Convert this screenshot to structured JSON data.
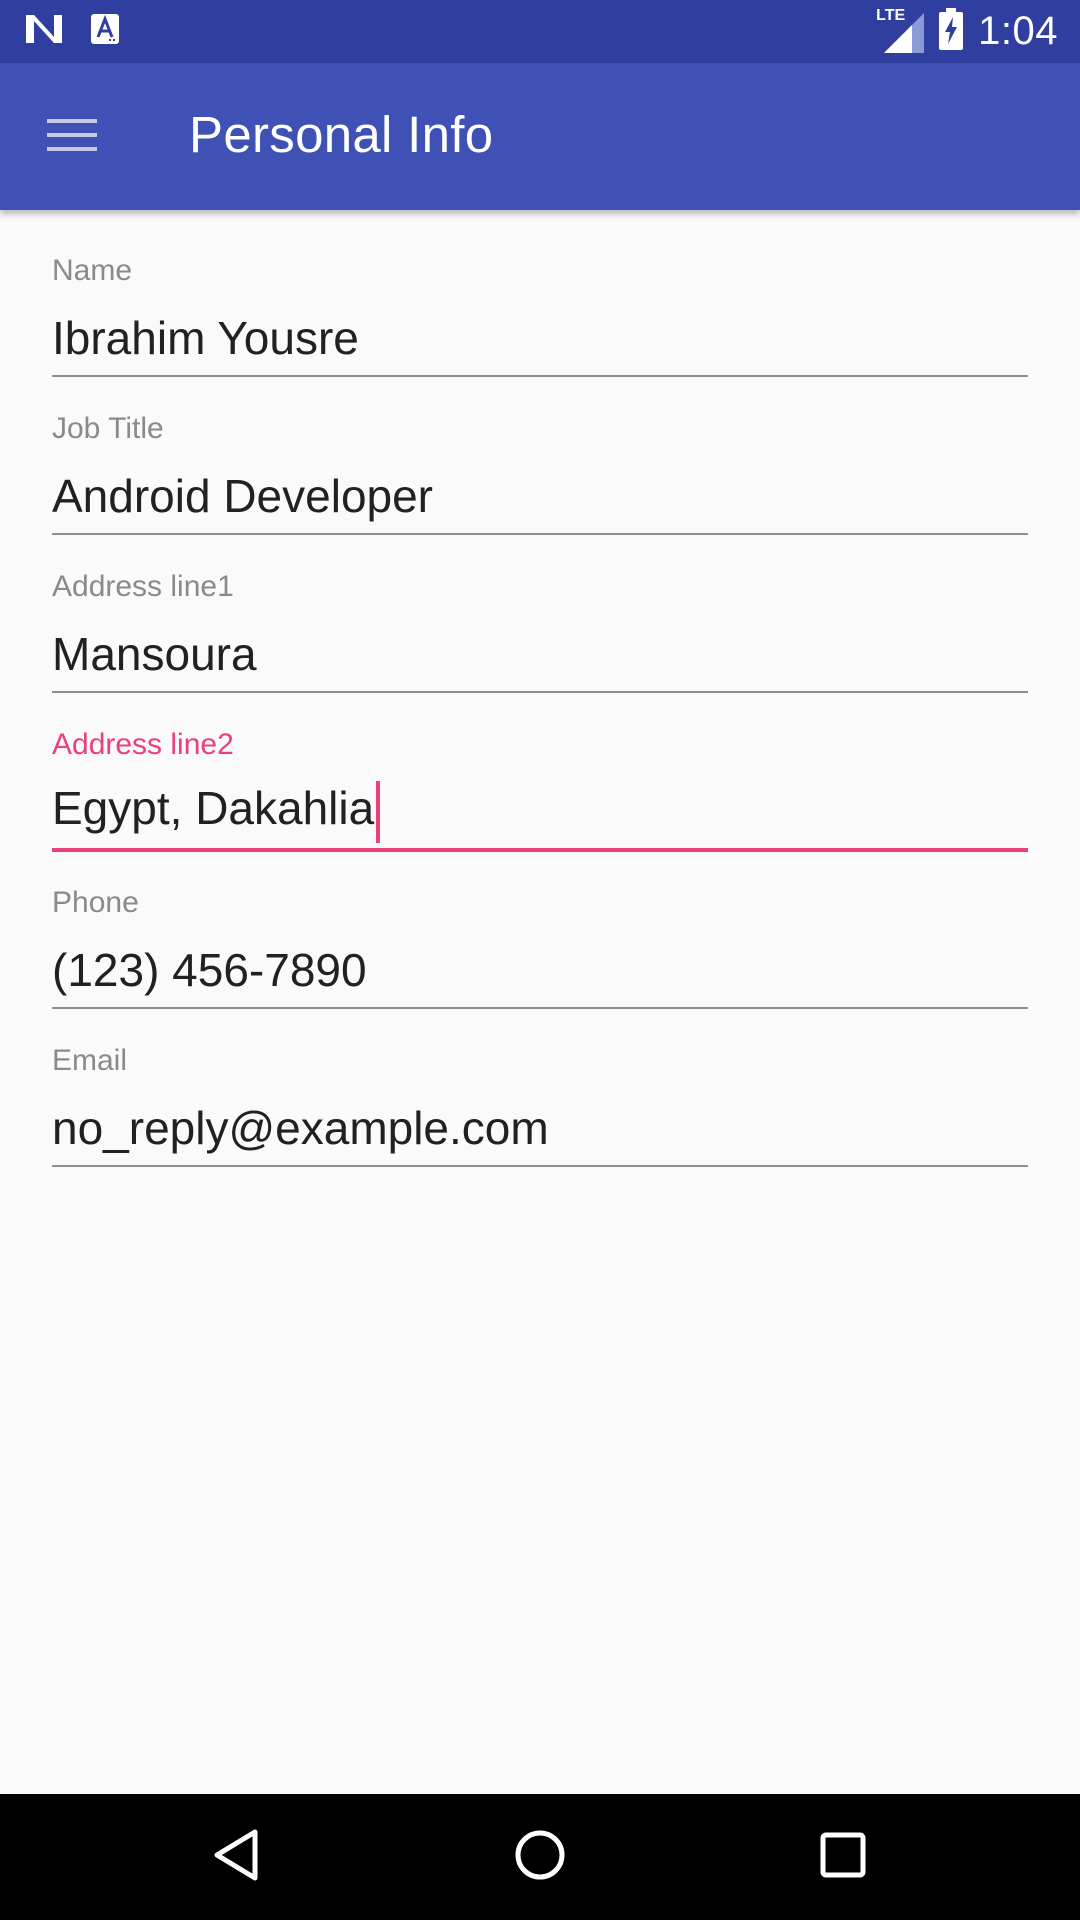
{
  "status_bar": {
    "left_icons": [
      "n-logo-icon",
      "translate-a-icon"
    ],
    "network_label": "LTE",
    "time": "1:04"
  },
  "app_bar": {
    "title": "Personal Info",
    "menu_icon": "hamburger-menu-icon"
  },
  "colors": {
    "status_bar": "#303f9f",
    "app_bar": "#3f51b5",
    "accent": "#ec407a",
    "background": "#fafafa"
  },
  "form": {
    "fields": [
      {
        "label": "Name",
        "value": "Ibrahim Yousre"
      },
      {
        "label": "Job Title",
        "value": "Android Developer"
      },
      {
        "label": "Address line1",
        "value": "Mansoura"
      },
      {
        "label": "Address line2",
        "value": "Egypt, Dakahlia",
        "focused": true
      },
      {
        "label": "Phone",
        "value": "(123) 456-7890"
      },
      {
        "label": "Email",
        "value": "no_reply@example.com"
      }
    ]
  },
  "nav_bar": {
    "buttons": [
      "back-icon",
      "home-icon",
      "recents-icon"
    ]
  }
}
